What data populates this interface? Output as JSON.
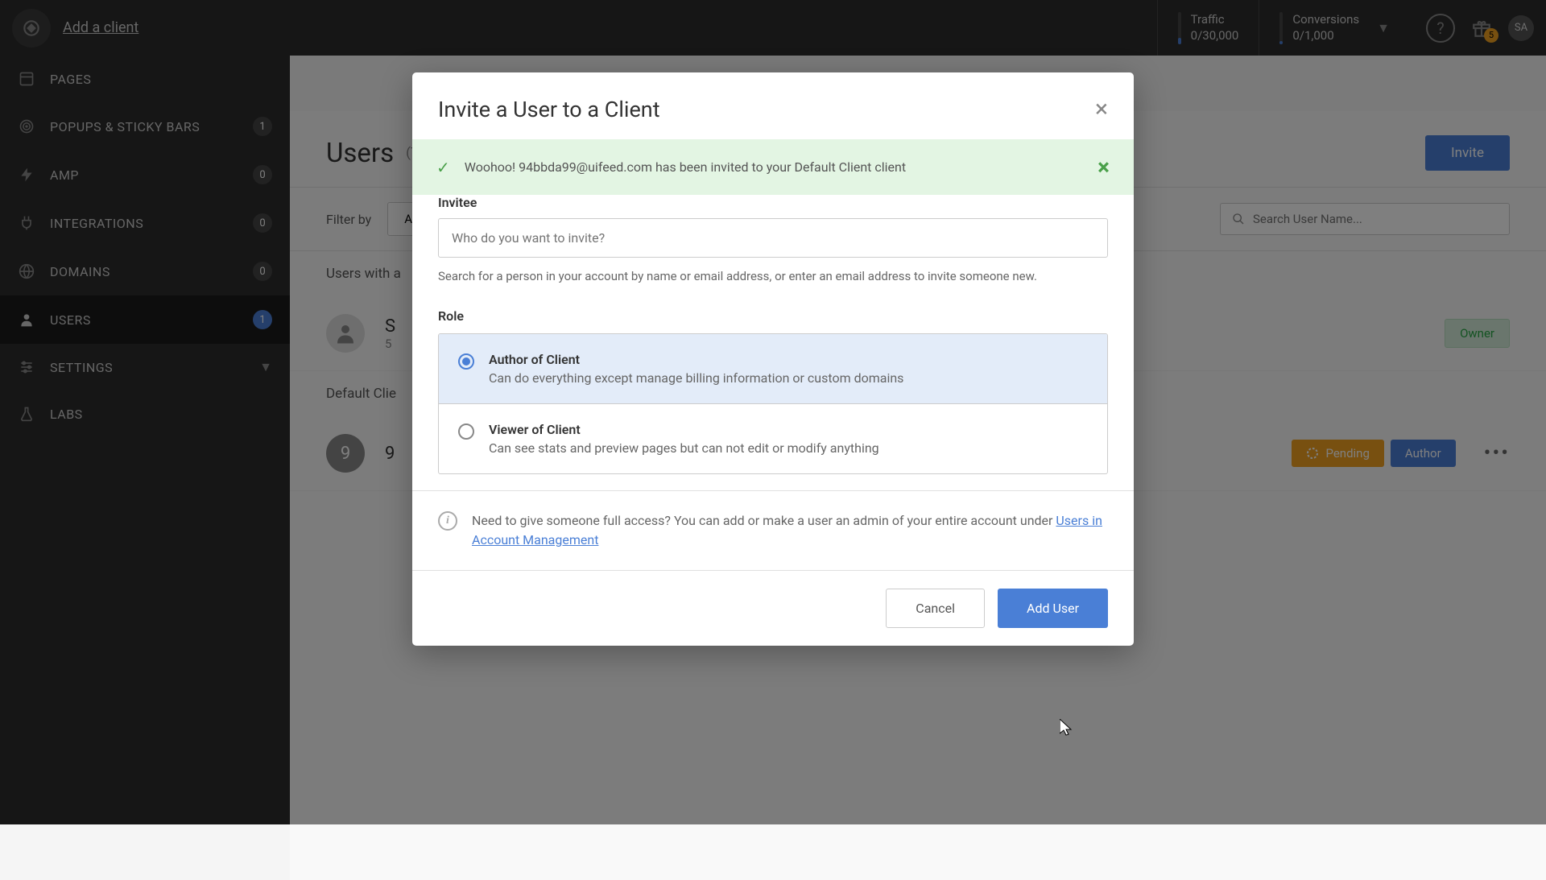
{
  "topbar": {
    "add_client": "Add a client",
    "traffic_label": "Traffic",
    "traffic_value": "0/30,000",
    "conversions_label": "Conversions",
    "conversions_value": "0/1,000",
    "gift_badge": "5",
    "avatar_initials": "SA"
  },
  "sidebar": {
    "items": [
      {
        "label": "PAGES"
      },
      {
        "label": "POPUPS & STICKY BARS",
        "badge": "1"
      },
      {
        "label": "AMP",
        "badge": "0"
      },
      {
        "label": "INTEGRATIONS",
        "badge": "0"
      },
      {
        "label": "DOMAINS",
        "badge": "0"
      },
      {
        "label": "USERS",
        "badge": "1"
      },
      {
        "label": "SETTINGS"
      },
      {
        "label": "LABS"
      }
    ]
  },
  "main": {
    "title": "Users",
    "subtitle": "(The",
    "invite_btn": "Invite",
    "filter_label": "Filter by",
    "filter_value": "A",
    "search_placeholder": "Search User Name...",
    "section_1": "Users with a",
    "user1_initial": "S",
    "user1_email_prefix": "5",
    "owner_badge": "Owner",
    "section_2": "Default Clie",
    "user2_letter": "9",
    "user2_name": "9",
    "pending_badge": "Pending",
    "author_badge": "Author"
  },
  "dialog": {
    "title": "Invite a User to a Client",
    "success_msg": "Woohoo! 94bbda99@uifeed.com has been invited to your Default Client client",
    "invitee_label": "Invitee",
    "invitee_placeholder": "Who do you want to invite?",
    "invitee_hint": "Search for a person in your account by name or email address, or enter an email address to invite someone new.",
    "role_label": "Role",
    "role_author_title": "Author of Client",
    "role_author_desc": "Can do everything except manage billing information or custom domains",
    "role_viewer_title": "Viewer of Client",
    "role_viewer_desc": "Can see stats and preview pages but can not edit or modify anything",
    "info_text": "Need to give someone full access? You can add or make a user an admin of your entire account under ",
    "info_link": "Users in Account Management",
    "cancel_btn": "Cancel",
    "add_user_btn": "Add User"
  }
}
